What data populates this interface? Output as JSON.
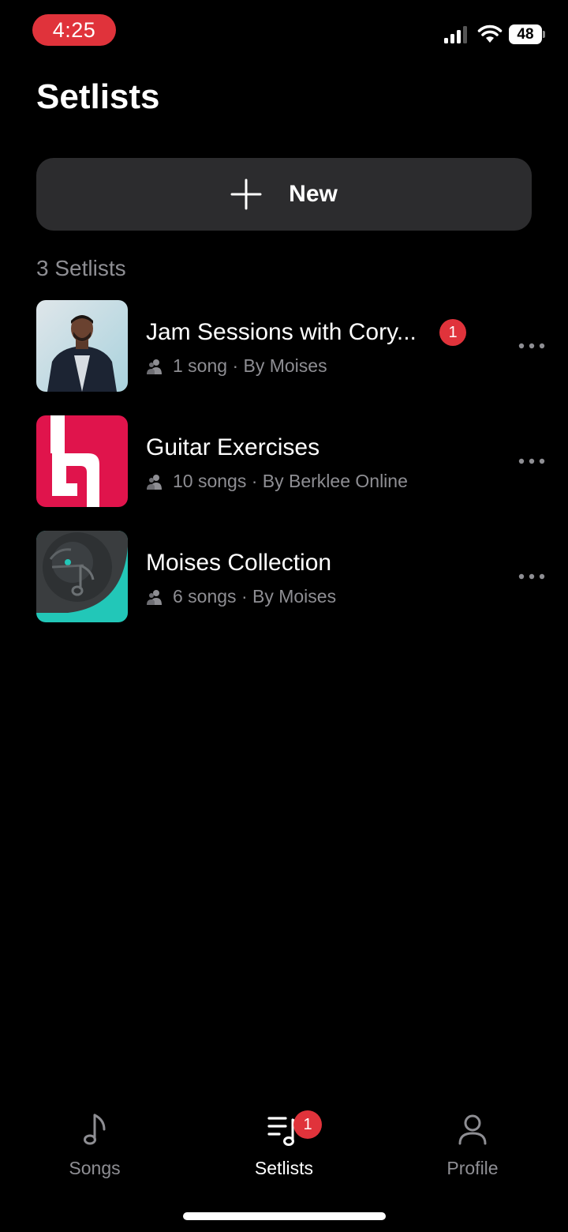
{
  "status_bar": {
    "time": "4:25",
    "battery": "48",
    "icons": [
      "signal-icon",
      "wifi-icon",
      "battery-icon"
    ]
  },
  "header": {
    "title": "Setlists"
  },
  "new_button": {
    "label": "New",
    "icon": "plus-icon"
  },
  "setlists_count": "3 Setlists",
  "setlists": [
    {
      "title": "Jam Sessions with Cory...",
      "meta": "1 song · By Moises",
      "badge": "1",
      "icon": "shared-users-icon"
    },
    {
      "title": "Guitar Exercises",
      "meta": "10 songs · By Berklee Online",
      "icon": "shared-users-icon"
    },
    {
      "title": "Moises Collection",
      "meta": "6 songs · By Moises",
      "icon": "shared-users-icon"
    }
  ],
  "tab_bar": {
    "tabs": [
      {
        "label": "Songs",
        "icon": "music-note-icon",
        "active": false
      },
      {
        "label": "Setlists",
        "icon": "setlist-icon",
        "active": true,
        "badge": "1"
      },
      {
        "label": "Profile",
        "icon": "person-icon",
        "active": false
      }
    ]
  },
  "colors": {
    "accent_red": "#e0333b",
    "button_bg": "#2c2c2e",
    "secondary_text": "#8e8e93",
    "berklee_red": "#e0144c",
    "moises_teal": "#22c7b8"
  }
}
